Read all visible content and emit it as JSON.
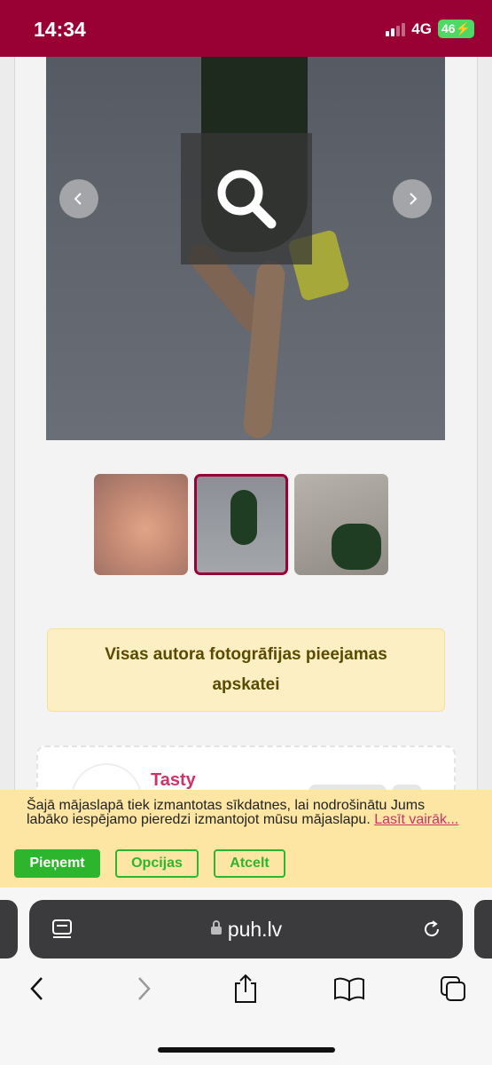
{
  "status_bar": {
    "time": "14:34",
    "network": "4G",
    "battery": "46",
    "signal_bars": 4,
    "signal_bars_active": 2,
    "colors": {
      "background": "#990033"
    }
  },
  "gallery": {
    "zoom_icon": "search-icon",
    "prev_icon": "chevron-left-icon",
    "next_icon": "chevron-right-icon",
    "thumbnails_count": 3,
    "active_thumbnail": 2
  },
  "notice": {
    "text": "Visas autora fotogrāfijas pieejamas apskatei"
  },
  "profile": {
    "name": "Tasty"
  },
  "cookie_banner": {
    "text": "Šajā mājaslapā tiek izmantotas sīkdatnes, lai nodrošinātu Jums labāko iespējamo pieredzi izmantojot mūsu mājaslapu.",
    "link": "Lasīt vairāk...",
    "accept": "Pieņemt",
    "options": "Opcijas",
    "cancel": "Atcelt",
    "colors": {
      "accent": "#2db52d",
      "background": "#fde6a3",
      "link": "#cc3366"
    }
  },
  "browser": {
    "url": "puh.lv",
    "page_menu_icon": "page-menu-icon",
    "reload_icon": "reload-icon",
    "toolbar": [
      "back-icon",
      "forward-icon",
      "share-icon",
      "bookmarks-icon",
      "tabs-icon"
    ]
  }
}
